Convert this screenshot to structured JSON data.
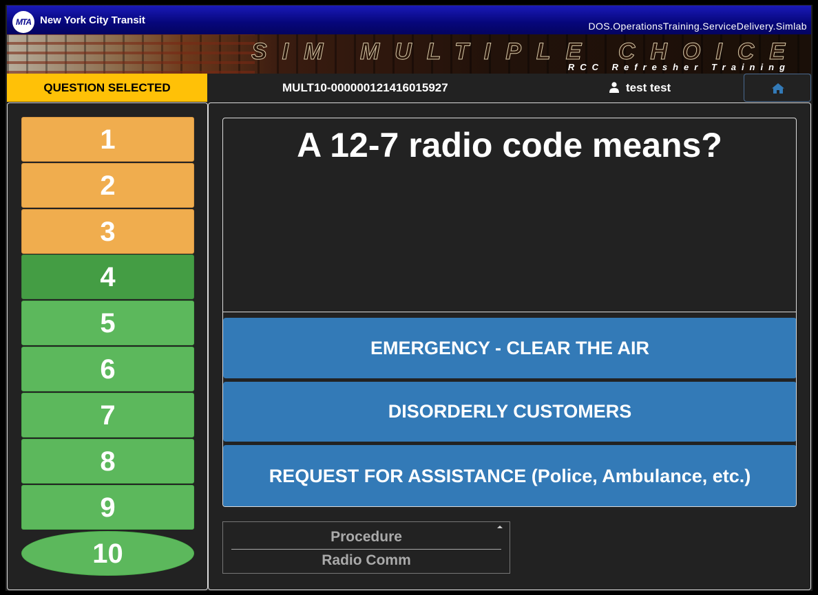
{
  "header": {
    "logo_text": "MTA",
    "agency_name": "New York City Transit",
    "app_path": "DOS.OperationsTraining.ServiceDelivery.Simlab",
    "banner_title": "SIM MULTIPLE CHOICE",
    "banner_subtitle": "RCC Refresher Training"
  },
  "status": {
    "selected_label": "QUESTION SELECTED",
    "session_id": "MULT10-000000121416015927",
    "user_name": "test test",
    "home_icon": "home-icon",
    "user_icon": "user-icon"
  },
  "questions": [
    {
      "label": "1",
      "state": "answered"
    },
    {
      "label": "2",
      "state": "answered"
    },
    {
      "label": "3",
      "state": "answered"
    },
    {
      "label": "4",
      "state": "active"
    },
    {
      "label": "5",
      "state": "unanswered"
    },
    {
      "label": "6",
      "state": "unanswered"
    },
    {
      "label": "7",
      "state": "unanswered"
    },
    {
      "label": "8",
      "state": "unanswered"
    },
    {
      "label": "9",
      "state": "unanswered"
    },
    {
      "label": "10",
      "state": "current"
    }
  ],
  "question": {
    "text": "A 12-7 radio code means?",
    "answers": [
      "EMERGENCY - CLEAR THE AIR",
      "DISORDERLY CUSTOMERS",
      "REQUEST FOR ASSISTANCE (Police, Ambulance, etc.)"
    ]
  },
  "tags": {
    "category": "Procedure",
    "subcategory": "Radio Comm"
  },
  "colors": {
    "answered": "#f0ad4e",
    "unanswered": "#5cb85c",
    "active": "#449d44",
    "answer_button": "#337ab7",
    "selected_badge": "#ffc107"
  }
}
